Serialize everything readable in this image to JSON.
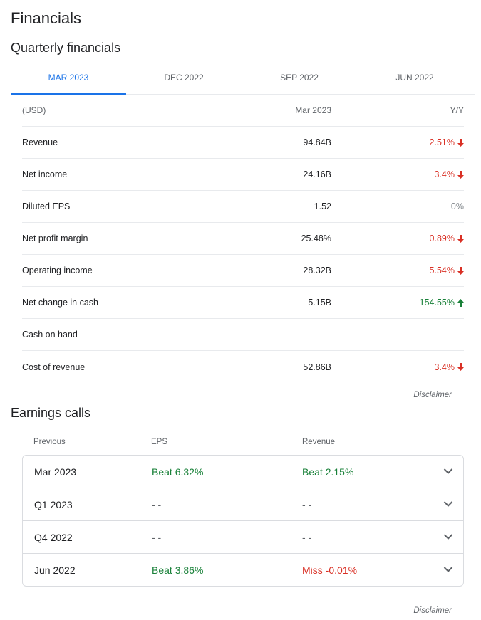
{
  "page_title": "Financials",
  "quarterly": {
    "title": "Quarterly financials",
    "tabs": [
      {
        "label": "MAR 2023",
        "active": true
      },
      {
        "label": "DEC 2022",
        "active": false
      },
      {
        "label": "SEP 2022",
        "active": false
      },
      {
        "label": "JUN 2022",
        "active": false
      }
    ],
    "header": {
      "label": "(USD)",
      "value": "Mar 2023",
      "change": "Y/Y"
    },
    "rows": [
      {
        "label": "Revenue",
        "value": "94.84B",
        "change": "2.51%",
        "direction": "down"
      },
      {
        "label": "Net income",
        "value": "24.16B",
        "change": "3.4%",
        "direction": "down"
      },
      {
        "label": "Diluted EPS",
        "value": "1.52",
        "change": "0%",
        "direction": "flat"
      },
      {
        "label": "Net profit margin",
        "value": "25.48%",
        "change": "0.89%",
        "direction": "down"
      },
      {
        "label": "Operating income",
        "value": "28.32B",
        "change": "5.54%",
        "direction": "down"
      },
      {
        "label": "Net change in cash",
        "value": "5.15B",
        "change": "154.55%",
        "direction": "up"
      },
      {
        "label": "Cash on hand",
        "value": "-",
        "change": "-",
        "direction": "flat"
      },
      {
        "label": "Cost of revenue",
        "value": "52.86B",
        "change": "3.4%",
        "direction": "down"
      }
    ],
    "disclaimer": "Disclaimer"
  },
  "earnings": {
    "title": "Earnings calls",
    "header": {
      "previous": "Previous",
      "eps": "EPS",
      "revenue": "Revenue"
    },
    "rows": [
      {
        "period": "Mar 2023",
        "eps": "Beat 6.32%",
        "eps_status": "beat",
        "revenue": "Beat 2.15%",
        "revenue_status": "beat"
      },
      {
        "period": "Q1 2023",
        "eps": "- -",
        "eps_status": "none",
        "revenue": "- -",
        "revenue_status": "none"
      },
      {
        "period": "Q4 2022",
        "eps": "- -",
        "eps_status": "none",
        "revenue": "- -",
        "revenue_status": "none"
      },
      {
        "period": "Jun 2022",
        "eps": "Beat 3.86%",
        "eps_status": "beat",
        "revenue": "Miss -0.01%",
        "revenue_status": "miss"
      }
    ],
    "disclaimer": "Disclaimer"
  },
  "colors": {
    "accent": "#1a73e8",
    "positive": "#188038",
    "negative": "#d93025",
    "neutral": "#80868b"
  }
}
